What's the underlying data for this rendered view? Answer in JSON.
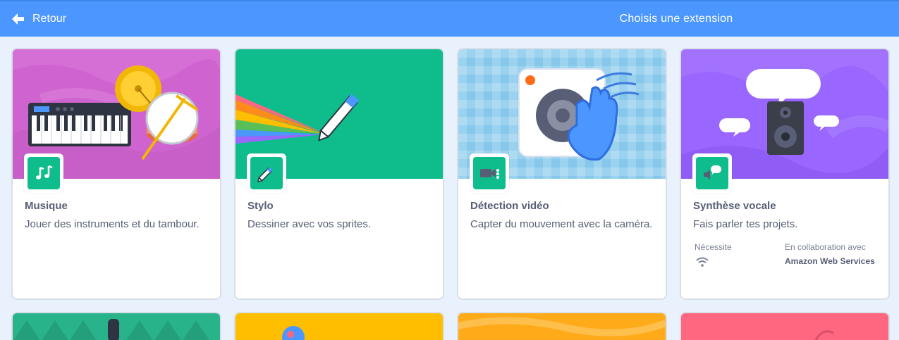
{
  "header": {
    "back_label": "Retour",
    "title": "Choisis une extension"
  },
  "extensions": [
    {
      "name": "Musique",
      "description": "Jouer des instruments et du tambour.",
      "color": "#cf63cf",
      "icon": "music-notes-icon"
    },
    {
      "name": "Stylo",
      "description": "Dessiner avec vos sprites.",
      "color": "#0fbd8c",
      "icon": "pen-icon"
    },
    {
      "name": "Détection vidéo",
      "description": "Capter du mouvement avec la caméra.",
      "color": "#9ad2ef",
      "icon": "video-camera-icon"
    },
    {
      "name": "Synthèse vocale",
      "description": "Fais parler tes projets.",
      "color": "#9966ff",
      "icon": "speaker-bubble-icon",
      "requires_label": "Nécessite",
      "requires_icon": "wifi-icon",
      "collaboration_label": "En collaboration avec",
      "collaboration_value": "Amazon Web Services"
    }
  ],
  "partial_cards": [
    {
      "color": "#29b38b"
    },
    {
      "color": "#ffbf00"
    },
    {
      "color": "#ffab19"
    },
    {
      "color": "#ff6680"
    }
  ]
}
